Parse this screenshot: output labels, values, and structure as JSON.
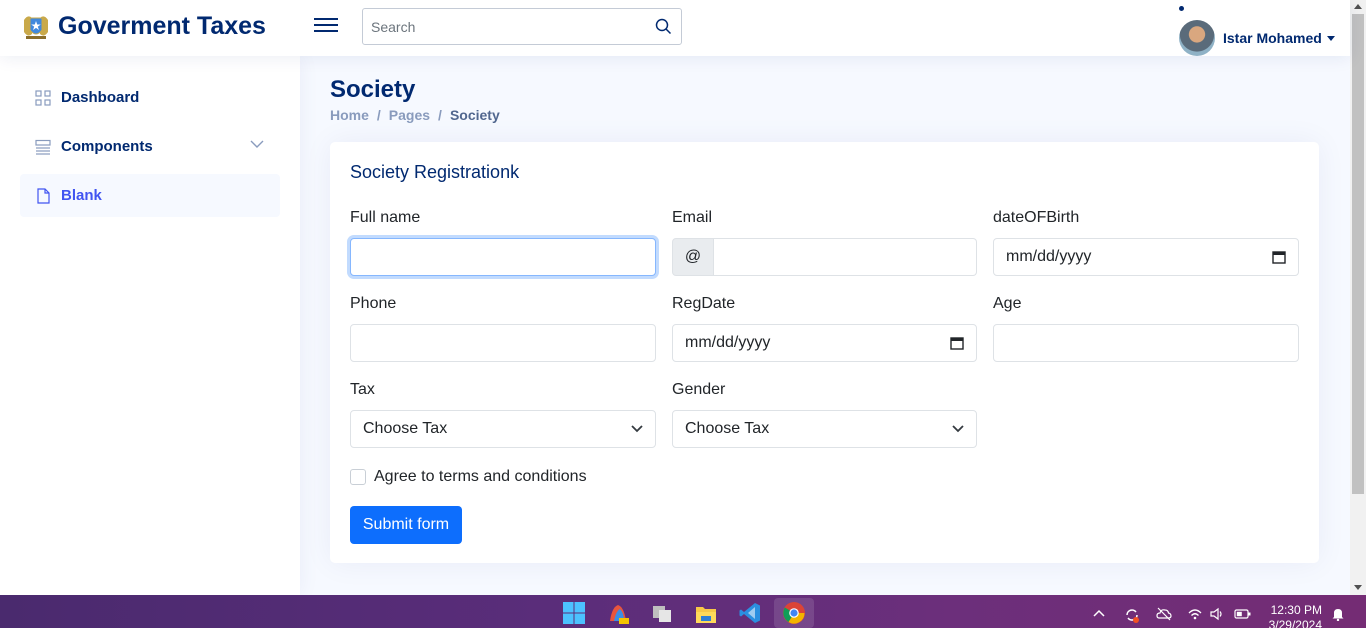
{
  "header": {
    "app_title": "Goverment Taxes",
    "search_placeholder": "Search",
    "user_name": "Istar Mohamed"
  },
  "sidebar": {
    "items": [
      {
        "label": "Dashboard",
        "icon": "grid-icon"
      },
      {
        "label": "Components",
        "icon": "menu-button-icon"
      },
      {
        "label": "Blank",
        "icon": "file-icon",
        "active": true
      }
    ]
  },
  "page": {
    "title": "Society",
    "breadcrumb": [
      "Home",
      "Pages",
      "Society"
    ]
  },
  "form": {
    "title": "Society Registrationk",
    "full_name_label": "Full name",
    "email_label": "Email",
    "email_prefix": "@",
    "dob_label": "dateOFBirth",
    "dob_placeholder": "mm/dd/yyyy",
    "phone_label": "Phone",
    "regdate_label": "RegDate",
    "regdate_placeholder": "mm/dd/yyyy",
    "age_label": "Age",
    "tax_label": "Tax",
    "tax_selected": "Choose Tax",
    "gender_label": "Gender",
    "gender_selected": "Choose Tax",
    "terms_label": "Agree to terms and conditions",
    "submit_label": "Submit form"
  },
  "taskbar": {
    "time": "12:30 PM",
    "date": "3/29/2024"
  },
  "colors": {
    "brand": "#012970",
    "accent": "#4154f1",
    "primary_button": "#0d6efd"
  }
}
